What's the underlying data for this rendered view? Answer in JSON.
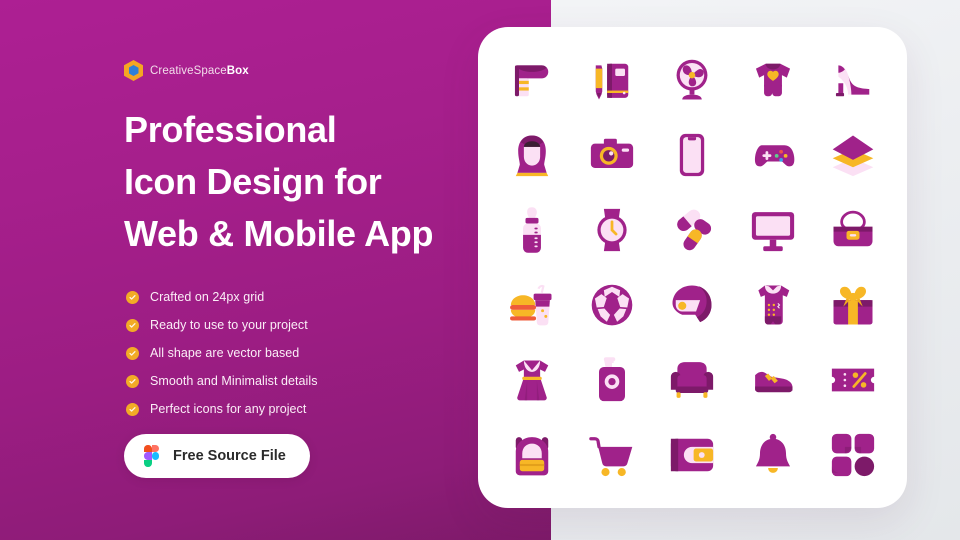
{
  "theme": {
    "panel_gradient_from": "#ad1f93",
    "panel_gradient_to": "#7d1a69",
    "page_background": "#eceef1",
    "card_background": "#ffffff",
    "icon_dark": "#a0228a",
    "icon_deep": "#7d1a69",
    "icon_light": "#fbe0f4",
    "icon_accent": "#f7b726",
    "check_color": "#f2ab26",
    "headline_color": "#ffffff",
    "cta_text_color": "#2b2b2b"
  },
  "brand": {
    "name_light": "CreativeSpace",
    "name_bold": "Box",
    "logo_icon": "hexagon-cube-logo"
  },
  "headline": {
    "line1": "Professional",
    "line2": "Icon Design for",
    "line3": "Web & Mobile App"
  },
  "features": [
    {
      "icon": "check-circle-icon",
      "label": "Crafted on 24px grid"
    },
    {
      "icon": "check-circle-icon",
      "label": "Ready to use to your project"
    },
    {
      "icon": "check-circle-icon",
      "label": "All shape are vector based"
    },
    {
      "icon": "check-circle-icon",
      "label": "Smooth and Minimalist details"
    },
    {
      "icon": "check-circle-icon",
      "label": "Perfect icons for any project"
    }
  ],
  "cta": {
    "label": "Free Source File",
    "icon": "figma-logo-icon"
  },
  "icon_showcase": {
    "columns": 5,
    "rows": 6,
    "icons": [
      "hair-dryer-icon",
      "notebook-pencil-icon",
      "table-fan-icon",
      "baby-onesie-icon",
      "high-heel-shoe-icon",
      "hijab-woman-icon",
      "photo-camera-icon",
      "smartphone-icon",
      "game-controller-icon",
      "layers-icon",
      "baby-bottle-icon",
      "wristwatch-icon",
      "medicine-capsules-icon",
      "monitor-screen-icon",
      "handbag-icon",
      "burger-drink-icon",
      "soccer-ball-icon",
      "motorcycle-helmet-icon",
      "safety-vest-icon",
      "gift-box-icon",
      "dress-icon",
      "soap-dispenser-icon",
      "armchair-icon",
      "dress-shoe-icon",
      "discount-ticket-icon",
      "backpack-icon",
      "shopping-cart-icon",
      "wallet-icon",
      "notification-bell-icon",
      "apps-grid-icon"
    ]
  }
}
